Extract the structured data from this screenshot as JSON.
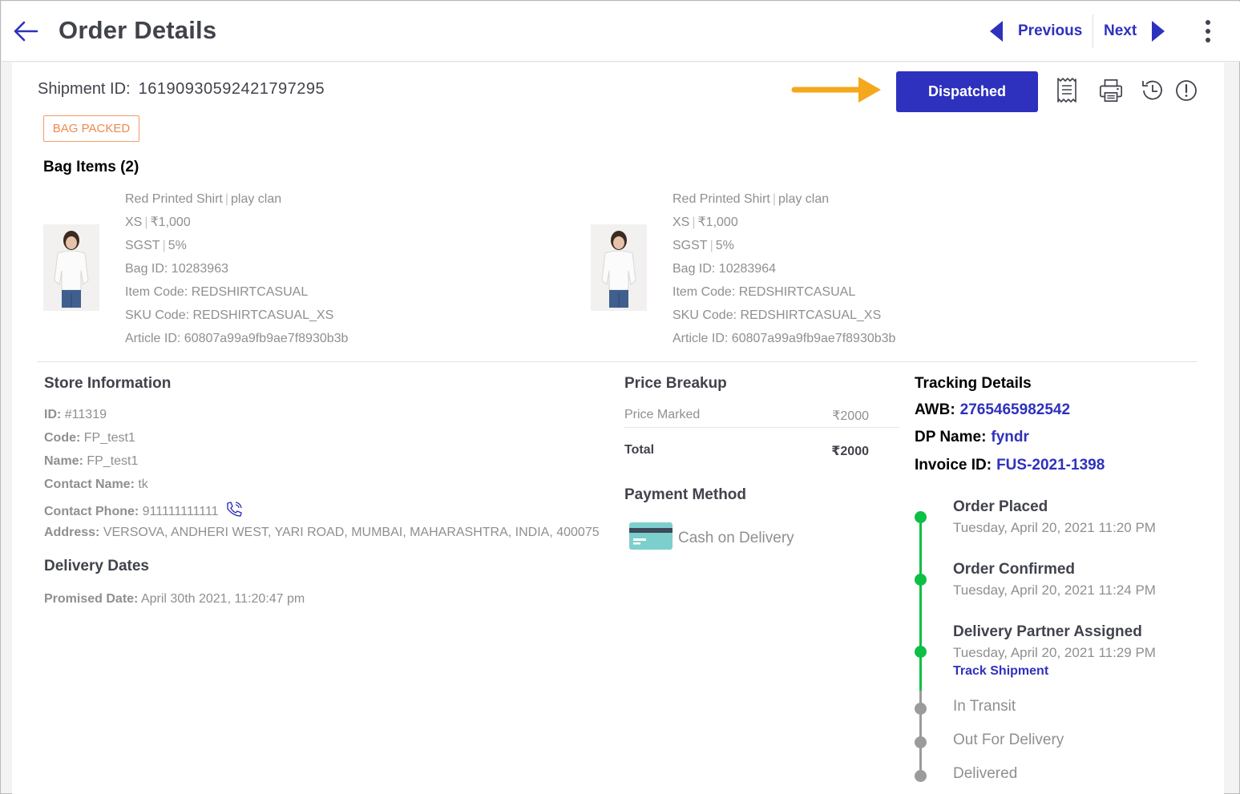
{
  "header": {
    "title": "Order Details",
    "previous_label": "Previous",
    "next_label": "Next"
  },
  "shipment": {
    "id_label": "Shipment ID:",
    "id_value": "16190930592421797295",
    "status_badge": "BAG PACKED",
    "action_button": "Dispatched"
  },
  "bag_items": {
    "title": "Bag Items (2)",
    "items": [
      {
        "name": "Red Printed Shirt",
        "brand": "play clan",
        "size": "XS",
        "price": "₹1,000",
        "tax_name": "SGST",
        "tax_rate": "5%",
        "bag_id": "Bag ID: 10283963",
        "item_code": "Item Code: REDSHIRTCASUAL",
        "sku_code": "SKU Code: REDSHIRTCASUAL_XS",
        "article_id": "Article ID: 60807a99a9fb9ae7f8930b3b"
      },
      {
        "name": "Red Printed Shirt",
        "brand": "play clan",
        "size": "XS",
        "price": "₹1,000",
        "tax_name": "SGST",
        "tax_rate": "5%",
        "bag_id": "Bag ID: 10283964",
        "item_code": "Item Code: REDSHIRTCASUAL",
        "sku_code": "SKU Code: REDSHIRTCASUAL_XS",
        "article_id": "Article ID: 60807a99a9fb9ae7f8930b3b"
      }
    ]
  },
  "store": {
    "title": "Store Information",
    "id_label": "ID:",
    "id_value": "#11319",
    "code_label": "Code:",
    "code_value": "FP_test1",
    "name_label": "Name:",
    "name_value": "FP_test1",
    "contact_name_label": "Contact Name:",
    "contact_name_value": "tk",
    "contact_phone_label": "Contact Phone:",
    "contact_phone_value": "911111111111",
    "address_label": "Address:",
    "address_value": "VERSOVA, ANDHERI WEST, YARI ROAD, MUMBAI, MAHARASHTRA, INDIA, 400075"
  },
  "delivery": {
    "title": "Delivery Dates",
    "promised_label": "Promised Date:",
    "promised_value": "April 30th 2021, 11:20:47 pm"
  },
  "price": {
    "title": "Price Breakup",
    "marked_label": "Price Marked",
    "marked_value": "₹2000",
    "total_label": "Total",
    "total_value": "₹2000"
  },
  "payment": {
    "title": "Payment Method",
    "method": "Cash on Delivery"
  },
  "tracking": {
    "title": "Tracking Details",
    "awb_label": "AWB:",
    "awb_value": "2765465982542",
    "dp_label": "DP Name:",
    "dp_value": "fyndr",
    "invoice_label": "Invoice ID:",
    "invoice_value": "FUS-2021-1398"
  },
  "timeline": {
    "order_placed": {
      "title": "Order Placed",
      "time": "Tuesday, April 20, 2021 11:20 PM"
    },
    "order_confirmed": {
      "title": "Order Confirmed",
      "time": "Tuesday, April 20, 2021 11:24 PM"
    },
    "partner_assigned": {
      "title": "Delivery Partner Assigned",
      "time": "Tuesday, April 20, 2021 11:29 PM",
      "link": "Track Shipment"
    },
    "in_transit": {
      "title": "In Transit"
    },
    "out_for_delivery": {
      "title": "Out For Delivery"
    },
    "delivered": {
      "title": "Delivered"
    }
  },
  "colors": {
    "primary": "#2e31be",
    "badge_orange": "#f0884e",
    "done_green": "#0dc045",
    "pending_gray": "#9b9b9b",
    "annotation_arrow": "#f4a81d"
  },
  "icons": [
    "back-arrow-icon",
    "triangle-left-icon",
    "triangle-right-icon",
    "kebab-menu-icon",
    "receipt-icon",
    "printer-icon",
    "history-icon",
    "info-icon",
    "phone-icon",
    "credit-card-icon"
  ]
}
